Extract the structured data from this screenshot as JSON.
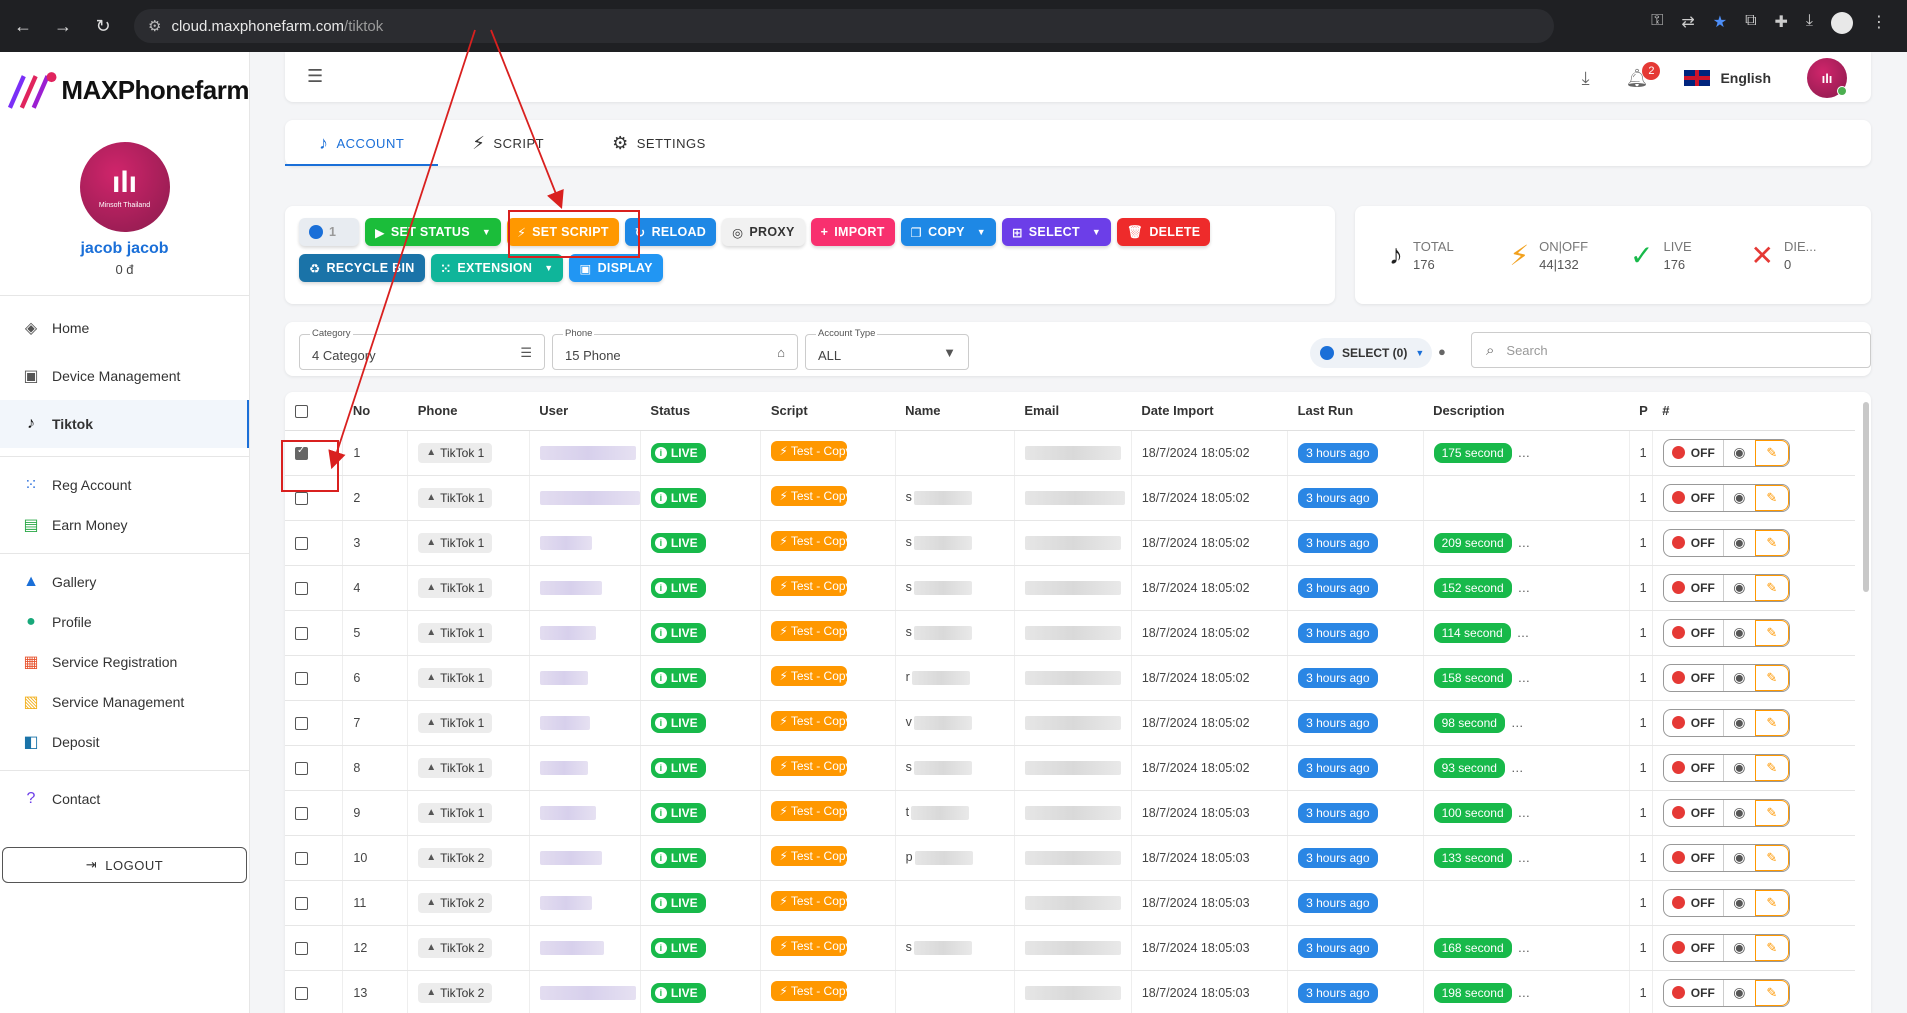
{
  "browser": {
    "url_host": "cloud.maxphonefarm.com",
    "url_path": "/tiktok"
  },
  "brand": {
    "logo_text": "MAXPhonefarm"
  },
  "profile": {
    "name": "jacob jacob",
    "balance": "0 đ",
    "avatar_caption": "Minsoft Thailand"
  },
  "sidebar": {
    "group1": [
      {
        "label": "Home",
        "icon": "layers-icon"
      },
      {
        "label": "Device Management",
        "icon": "device-icon"
      },
      {
        "label": "Tiktok",
        "icon": "tiktok-icon",
        "active": true
      }
    ],
    "group2": [
      {
        "label": "Reg Account",
        "icon": "reg-icon"
      },
      {
        "label": "Earn Money",
        "icon": "money-icon"
      }
    ],
    "group3": [
      {
        "label": "Gallery",
        "icon": "gallery-icon"
      },
      {
        "label": "Profile",
        "icon": "person-icon"
      },
      {
        "label": "Service Registration",
        "icon": "grid-icon"
      },
      {
        "label": "Service Management",
        "icon": "service-icon"
      },
      {
        "label": "Deposit",
        "icon": "deposit-icon"
      }
    ],
    "group4": [
      {
        "label": "Contact",
        "icon": "help-icon"
      }
    ],
    "logout": "LOGOUT"
  },
  "topbar": {
    "notifications": "2",
    "language": "English"
  },
  "tabs": [
    "ACCOUNT",
    "SCRIPT",
    "SETTINGS"
  ],
  "toolbar": {
    "toggle_count": "1",
    "set_status": "SET STATUS",
    "set_script": "SET SCRIPT",
    "reload": "RELOAD",
    "proxy": "PROXY",
    "import": "IMPORT",
    "copy": "COPY",
    "select": "SELECT",
    "delete": "DELETE",
    "recycle_bin": "RECYCLE BIN",
    "extension": "EXTENSION",
    "display": "DISPLAY"
  },
  "stats": [
    {
      "label": "TOTAL",
      "value": "176"
    },
    {
      "label": "ON|OFF",
      "value": "44|132"
    },
    {
      "label": "LIVE",
      "value": "176"
    },
    {
      "label": "DIE...",
      "value": "0"
    }
  ],
  "filters": {
    "category_label": "Category",
    "category_value": "4 Category",
    "phone_label": "Phone",
    "phone_value": "15 Phone",
    "account_type_label": "Account Type",
    "account_type_value": "ALL",
    "select_label": "SELECT (0)",
    "search_placeholder": "Search"
  },
  "table": {
    "headers": [
      "No",
      "Phone",
      "User",
      "Status",
      "Script",
      "Name",
      "Email",
      "Date Import",
      "Last Run",
      "Description",
      "P",
      "#"
    ],
    "rows": [
      {
        "no": "1",
        "phone": "TikTok 1",
        "status": "LIVE",
        "script": "Test - Copy",
        "name_initial": "",
        "date": "18/7/2024 18:05:02",
        "last_run": "3 hours ago",
        "desc": "175 second",
        "p": "1",
        "checked": true
      },
      {
        "no": "2",
        "phone": "TikTok 1",
        "status": "LIVE",
        "script": "Test - Copy",
        "name_initial": "s",
        "date": "18/7/2024 18:05:02",
        "last_run": "3 hours ago",
        "desc": "",
        "p": "1"
      },
      {
        "no": "3",
        "phone": "TikTok 1",
        "status": "LIVE",
        "script": "Test - Copy",
        "name_initial": "s",
        "date": "18/7/2024 18:05:02",
        "last_run": "3 hours ago",
        "desc": "209 second",
        "p": "1"
      },
      {
        "no": "4",
        "phone": "TikTok 1",
        "status": "LIVE",
        "script": "Test - Copy",
        "name_initial": "s",
        "date": "18/7/2024 18:05:02",
        "last_run": "3 hours ago",
        "desc": "152 second",
        "p": "1"
      },
      {
        "no": "5",
        "phone": "TikTok 1",
        "status": "LIVE",
        "script": "Test - Copy",
        "name_initial": "s",
        "date": "18/7/2024 18:05:02",
        "last_run": "3 hours ago",
        "desc": "114 second",
        "p": "1"
      },
      {
        "no": "6",
        "phone": "TikTok 1",
        "status": "LIVE",
        "script": "Test - Copy",
        "name_initial": "r",
        "date": "18/7/2024 18:05:02",
        "last_run": "3 hours ago",
        "desc": "158 second",
        "p": "1"
      },
      {
        "no": "7",
        "phone": "TikTok 1",
        "status": "LIVE",
        "script": "Test - Copy",
        "name_initial": "v",
        "date": "18/7/2024 18:05:02",
        "last_run": "3 hours ago",
        "desc": "98 second",
        "p": "1"
      },
      {
        "no": "8",
        "phone": "TikTok 1",
        "status": "LIVE",
        "script": "Test - Copy",
        "name_initial": "s",
        "date": "18/7/2024 18:05:02",
        "last_run": "3 hours ago",
        "desc": "93 second",
        "p": "1"
      },
      {
        "no": "9",
        "phone": "TikTok 1",
        "status": "LIVE",
        "script": "Test - Copy",
        "name_initial": "t",
        "date": "18/7/2024 18:05:03",
        "last_run": "3 hours ago",
        "desc": "100 second",
        "p": "1"
      },
      {
        "no": "10",
        "phone": "TikTok 2",
        "status": "LIVE",
        "script": "Test - Copy",
        "name_initial": "p",
        "date": "18/7/2024 18:05:03",
        "last_run": "3 hours ago",
        "desc": "133 second",
        "p": "1"
      },
      {
        "no": "11",
        "phone": "TikTok 2",
        "status": "LIVE",
        "script": "Test - Copy",
        "name_initial": "",
        "date": "18/7/2024 18:05:03",
        "last_run": "3 hours ago",
        "desc": "",
        "p": "1"
      },
      {
        "no": "12",
        "phone": "TikTok 2",
        "status": "LIVE",
        "script": "Test - Copy",
        "name_initial": "s",
        "date": "18/7/2024 18:05:03",
        "last_run": "3 hours ago",
        "desc": "168 second",
        "p": "1"
      },
      {
        "no": "13",
        "phone": "TikTok 2",
        "status": "LIVE",
        "script": "Test - Copy",
        "name_initial": "",
        "date": "18/7/2024 18:05:03",
        "last_run": "3 hours ago",
        "desc": "198 second",
        "p": "1"
      }
    ],
    "off_label": "OFF"
  },
  "colors": {
    "accent": "#1a6fd8",
    "annotation": "#d9201f"
  }
}
